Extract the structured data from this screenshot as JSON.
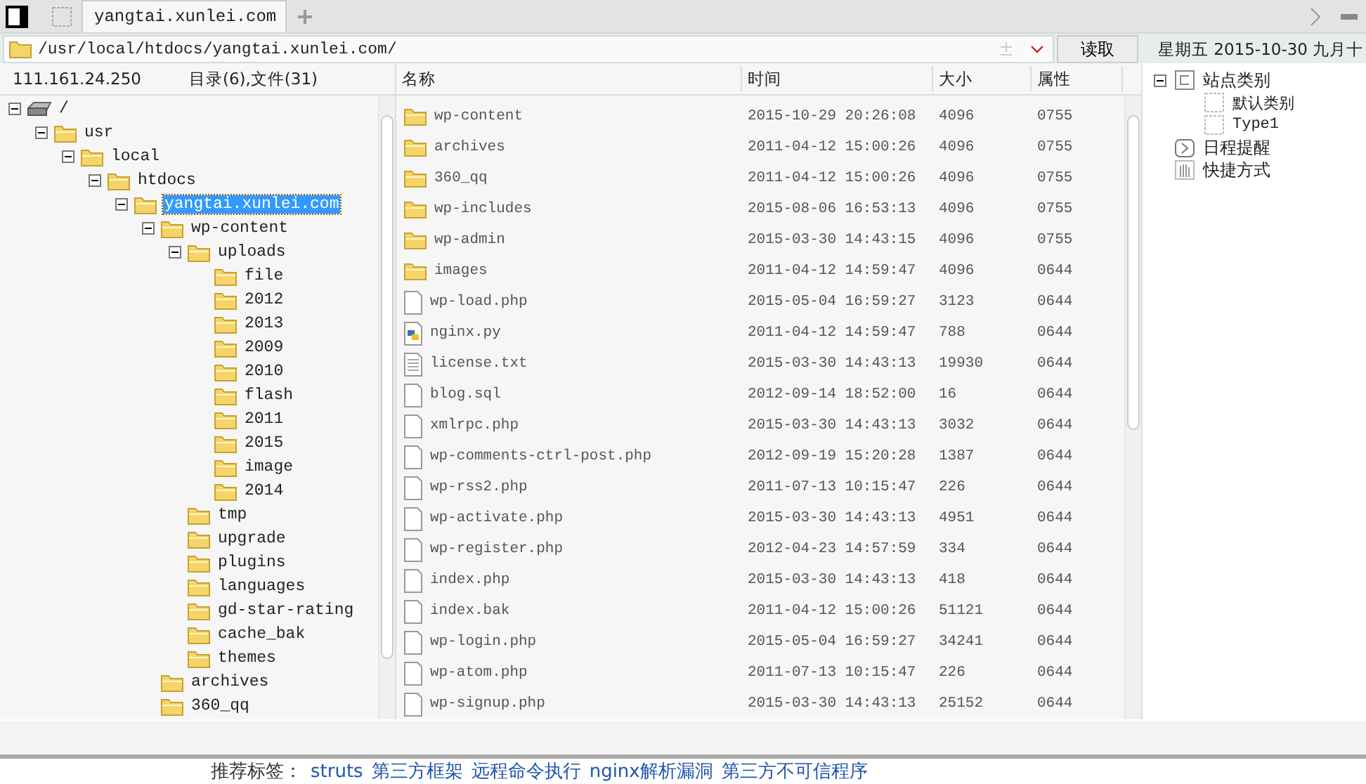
{
  "tab": {
    "title": "yangtai.xunlei.com",
    "selected": true
  },
  "address": {
    "value": "/usr/local/htdocs/yangtai.xunlei.com/",
    "button": "读取"
  },
  "server_ip": "111.161.24.250",
  "summary": "目录(6),文件(31)",
  "date": "星期五 2015-10-30 九月十",
  "tree": [
    {
      "label": "/",
      "kind": "drive",
      "expanded": true,
      "selected": false,
      "children": [
        {
          "label": "usr",
          "kind": "folder",
          "expanded": true,
          "selected": false,
          "children": [
            {
              "label": "local",
              "kind": "folder",
              "expanded": true,
              "selected": false,
              "children": [
                {
                  "label": "htdocs",
                  "kind": "folder",
                  "expanded": true,
                  "selected": false,
                  "children": [
                    {
                      "label": "yangtai.xunlei.com",
                      "kind": "folder",
                      "expanded": true,
                      "selected": true,
                      "children": [
                        {
                          "label": "wp-content",
                          "kind": "folder",
                          "expanded": true,
                          "selected": false,
                          "children": [
                            {
                              "label": "uploads",
                              "kind": "folder",
                              "expanded": true,
                              "selected": false,
                              "children": [
                                {
                                  "label": "file",
                                  "kind": "folder",
                                  "selected": false
                                },
                                {
                                  "label": "2012",
                                  "kind": "folder",
                                  "selected": false
                                },
                                {
                                  "label": "2013",
                                  "kind": "folder",
                                  "selected": false
                                },
                                {
                                  "label": "2009",
                                  "kind": "folder",
                                  "selected": false
                                },
                                {
                                  "label": "2010",
                                  "kind": "folder",
                                  "selected": false
                                },
                                {
                                  "label": "flash",
                                  "kind": "folder",
                                  "selected": false
                                },
                                {
                                  "label": "2011",
                                  "kind": "folder",
                                  "selected": false
                                },
                                {
                                  "label": "2015",
                                  "kind": "folder",
                                  "selected": false
                                },
                                {
                                  "label": "image",
                                  "kind": "folder",
                                  "selected": false
                                },
                                {
                                  "label": "2014",
                                  "kind": "folder",
                                  "selected": false
                                }
                              ]
                            },
                            {
                              "label": "tmp",
                              "kind": "folder",
                              "selected": false
                            },
                            {
                              "label": "upgrade",
                              "kind": "folder",
                              "selected": false
                            },
                            {
                              "label": "plugins",
                              "kind": "folder",
                              "selected": false
                            },
                            {
                              "label": "languages",
                              "kind": "folder",
                              "selected": false
                            },
                            {
                              "label": "gd-star-rating",
                              "kind": "folder",
                              "selected": false
                            },
                            {
                              "label": "cache_bak",
                              "kind": "folder",
                              "selected": false
                            },
                            {
                              "label": "themes",
                              "kind": "folder",
                              "selected": false
                            }
                          ]
                        },
                        {
                          "label": "archives",
                          "kind": "folder",
                          "selected": false
                        },
                        {
                          "label": "360_qq",
                          "kind": "folder",
                          "selected": false
                        }
                      ]
                    }
                  ]
                }
              ]
            }
          ]
        }
      ]
    }
  ],
  "columns": [
    "名称",
    "时间",
    "大小",
    "属性"
  ],
  "files": [
    {
      "name": "wp-content",
      "time": "2015-10-29 20:26:08",
      "size": "4096",
      "mode": "0755",
      "kind": "folder"
    },
    {
      "name": "archives",
      "time": "2011-04-12 15:00:26",
      "size": "4096",
      "mode": "0755",
      "kind": "folder"
    },
    {
      "name": "360_qq",
      "time": "2011-04-12 15:00:26",
      "size": "4096",
      "mode": "0755",
      "kind": "folder"
    },
    {
      "name": "wp-includes",
      "time": "2015-08-06 16:53:13",
      "size": "4096",
      "mode": "0755",
      "kind": "folder"
    },
    {
      "name": "wp-admin",
      "time": "2015-03-30 14:43:15",
      "size": "4096",
      "mode": "0755",
      "kind": "folder"
    },
    {
      "name": "images",
      "time": "2011-04-12 14:59:47",
      "size": "4096",
      "mode": "0644",
      "kind": "folder"
    },
    {
      "name": "wp-load.php",
      "time": "2015-05-04 16:59:27",
      "size": "3123",
      "mode": "0644",
      "kind": "file"
    },
    {
      "name": "nginx.py",
      "time": "2011-04-12 14:59:47",
      "size": "788",
      "mode": "0644",
      "kind": "python"
    },
    {
      "name": "license.txt",
      "time": "2015-03-30 14:43:13",
      "size": "19930",
      "mode": "0644",
      "kind": "text"
    },
    {
      "name": "blog.sql",
      "time": "2012-09-14 18:52:00",
      "size": "16",
      "mode": "0644",
      "kind": "file"
    },
    {
      "name": "xmlrpc.php",
      "time": "2015-03-30 14:43:13",
      "size": "3032",
      "mode": "0644",
      "kind": "file"
    },
    {
      "name": "wp-comments-ctrl-post.php",
      "time": "2012-09-19 15:20:28",
      "size": "1387",
      "mode": "0644",
      "kind": "file"
    },
    {
      "name": "wp-rss2.php",
      "time": "2011-07-13 10:15:47",
      "size": "226",
      "mode": "0644",
      "kind": "file"
    },
    {
      "name": "wp-activate.php",
      "time": "2015-03-30 14:43:13",
      "size": "4951",
      "mode": "0644",
      "kind": "file"
    },
    {
      "name": "wp-register.php",
      "time": "2012-04-23 14:57:59",
      "size": "334",
      "mode": "0644",
      "kind": "file"
    },
    {
      "name": "index.php",
      "time": "2015-03-30 14:43:13",
      "size": "418",
      "mode": "0644",
      "kind": "file"
    },
    {
      "name": "index.bak",
      "time": "2011-04-12 15:00:26",
      "size": "51121",
      "mode": "0644",
      "kind": "file"
    },
    {
      "name": "wp-login.php",
      "time": "2015-05-04 16:59:27",
      "size": "34241",
      "mode": "0644",
      "kind": "file"
    },
    {
      "name": "wp-atom.php",
      "time": "2011-07-13 10:15:47",
      "size": "226",
      "mode": "0644",
      "kind": "file"
    },
    {
      "name": "wp-signup.php",
      "time": "2015-03-30 14:43:13",
      "size": "25152",
      "mode": "0644",
      "kind": "file"
    }
  ],
  "side_tree": [
    {
      "label": "站点类别",
      "kind": "category",
      "expanded": true,
      "children": [
        {
          "label": "默认类别",
          "kind": "item"
        },
        {
          "label": "Type1",
          "kind": "item"
        }
      ]
    },
    {
      "label": "日程提醒",
      "kind": "schedule"
    },
    {
      "label": "快捷方式",
      "kind": "shortcut"
    }
  ],
  "tags": {
    "label": "推荐标签：",
    "links": [
      "struts",
      "第三方框架",
      "远程命令执行",
      "nginx解析漏洞",
      "第三方不可信程序"
    ]
  }
}
